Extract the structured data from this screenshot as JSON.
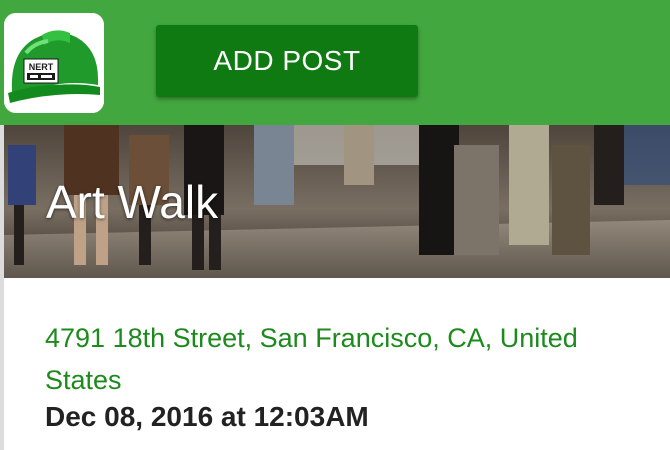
{
  "header": {
    "logo_text": "NERT",
    "add_post_label": "ADD POST",
    "brand_color": "#43a73f",
    "button_color": "#0f7a12"
  },
  "post": {
    "title": "Art Walk",
    "address": "4791 18th Street, San Francisco, CA, United States",
    "datetime": "Dec 08, 2016 at 12:03AM",
    "address_color": "#1d8a1d"
  },
  "icons": {
    "logo": "hard-hat-icon"
  }
}
